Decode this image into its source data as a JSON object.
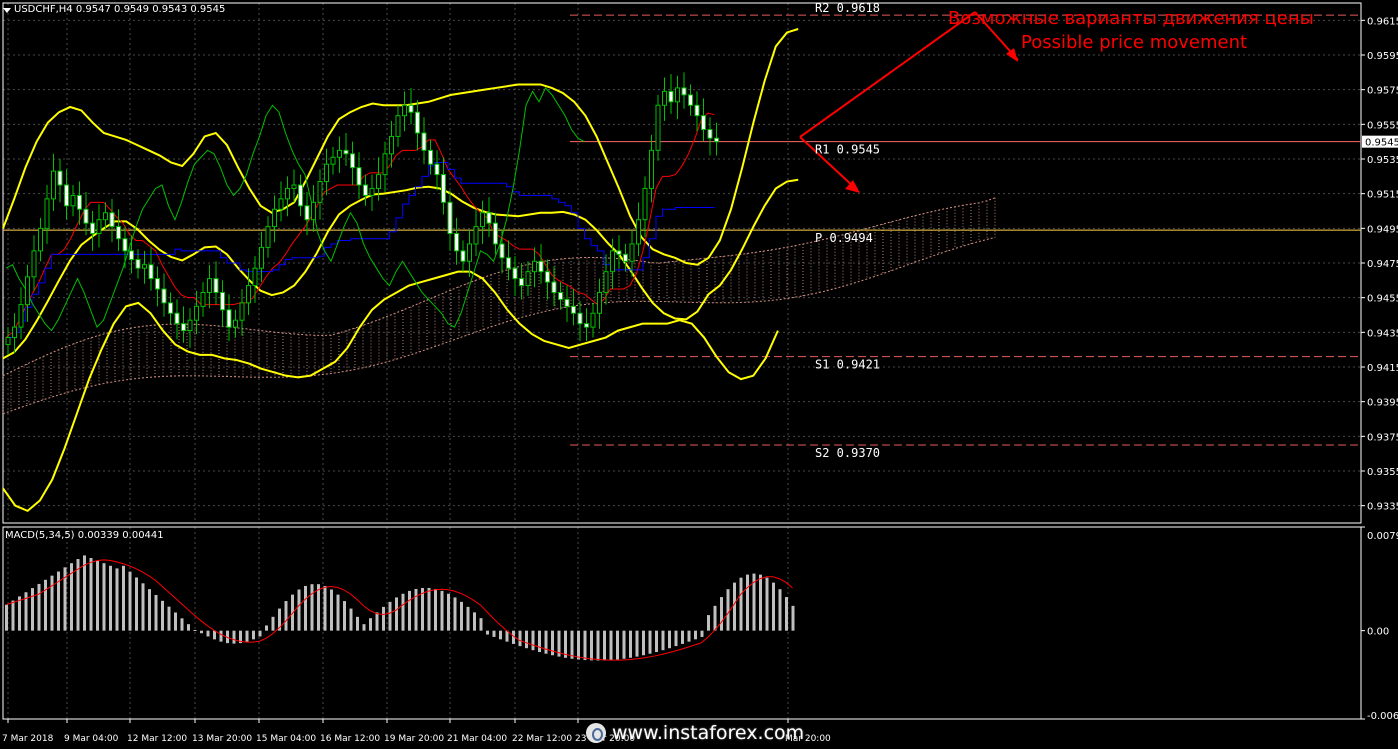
{
  "header": {
    "symbol_label": "USDCHF,H4  0.9547 0.9549 0.9543 0.9545"
  },
  "macd": {
    "label": "MACD(5,34,5) 0.00339 0.00441"
  },
  "annotations": {
    "note_ru": "Возможные варианты движения цены",
    "note_en": "Possible price movement"
  },
  "levels": [
    {
      "name": "R2",
      "label": "R2 0.9618",
      "value": 0.9618,
      "color": "#e85a5a"
    },
    {
      "name": "R1",
      "label": "R1 0.9545",
      "value": 0.9545,
      "color": "#ff6a6a"
    },
    {
      "name": "P",
      "label": "P 0.9494",
      "value": 0.9494,
      "color": "#ffd24d"
    },
    {
      "name": "S1",
      "label": "S1 0.9421",
      "value": 0.9421,
      "color": "#e85a5a"
    },
    {
      "name": "S2",
      "label": "S2 0.9370",
      "value": 0.937,
      "color": "#e85a5a"
    }
  ],
  "current_price": "0.9545",
  "watermark": "www.instaforex.com",
  "colors": {
    "background": "#000000",
    "bollinger": "#ffff00",
    "signal_line": "#ff0000",
    "kijun": "#0000ff",
    "chikou": "#00c000",
    "histogram": "#c0c0c0",
    "annotation": "#ff0000"
  },
  "chart_data": {
    "type": "candlestick",
    "symbol": "USDCHF",
    "timeframe": "H4",
    "ylim": [
      0.9325,
      0.9625
    ],
    "y_ticks": [
      "0.9615",
      "0.9595",
      "0.9575",
      "0.9555",
      "0.9535",
      "0.9515",
      "0.9495",
      "0.9475",
      "0.9455",
      "0.9435",
      "0.9415",
      "0.9395",
      "0.9375",
      "0.9355",
      "0.9335"
    ],
    "x_ticks": [
      "7 Mar 2018",
      "9 Mar 04:00",
      "12 Mar 12:00",
      "13 Mar 20:00",
      "15 Mar 04:00",
      "16 Mar 12:00",
      "19 Mar 20:00",
      "21 Mar 04:00",
      "22 Mar 12:00",
      "23 Mar 20:00",
      "Mar 20:00"
    ],
    "close": [
      0.9432,
      0.9438,
      0.9451,
      0.9467,
      0.9482,
      0.9495,
      0.9512,
      0.9528,
      0.952,
      0.9508,
      0.9514,
      0.9506,
      0.9498,
      0.9492,
      0.95,
      0.9504,
      0.9496,
      0.9489,
      0.9482,
      0.9477,
      0.9472,
      0.9474,
      0.9466,
      0.946,
      0.9452,
      0.9446,
      0.944,
      0.9436,
      0.9442,
      0.945,
      0.9458,
      0.9466,
      0.9458,
      0.9448,
      0.9438,
      0.9442,
      0.9452,
      0.9462,
      0.9472,
      0.9484,
      0.9496,
      0.9506,
      0.9512,
      0.9518,
      0.952,
      0.9508,
      0.95,
      0.951,
      0.9522,
      0.9532,
      0.9536,
      0.954,
      0.9538,
      0.953,
      0.952,
      0.9514,
      0.9518,
      0.9526,
      0.9538,
      0.9548,
      0.956,
      0.9566,
      0.9562,
      0.955,
      0.954,
      0.9532,
      0.9526,
      0.951,
      0.9492,
      0.9482,
      0.9476,
      0.9486,
      0.9496,
      0.9504,
      0.9498,
      0.9486,
      0.9478,
      0.9472,
      0.9466,
      0.9462,
      0.947,
      0.9476,
      0.947,
      0.9464,
      0.9458,
      0.9454,
      0.945,
      0.9446,
      0.944,
      0.9438,
      0.9446,
      0.9458,
      0.947,
      0.9482,
      0.948,
      0.9476,
      0.9486,
      0.95,
      0.9518,
      0.954,
      0.9566,
      0.9574,
      0.9568,
      0.9576,
      0.9572,
      0.9566,
      0.956,
      0.9552,
      0.9547,
      0.9545
    ],
    "bollinger_upper": [
      0.9495,
      0.9512,
      0.953,
      0.9545,
      0.9556,
      0.9562,
      0.9565,
      0.9563,
      0.9556,
      0.955,
      0.9548,
      0.9546,
      0.9543,
      0.954,
      0.9537,
      0.9533,
      0.9531,
      0.9538,
      0.9548,
      0.955,
      0.9543,
      0.953,
      0.9518,
      0.9508,
      0.9504,
      0.9506,
      0.951,
      0.9522,
      0.9535,
      0.9548,
      0.9558,
      0.9562,
      0.9565,
      0.9567,
      0.9566,
      0.9566,
      0.9566,
      0.9567,
      0.9568,
      0.957,
      0.9572,
      0.9573,
      0.9574,
      0.9575,
      0.9576,
      0.9577,
      0.9578,
      0.9578,
      0.9578,
      0.9576,
      0.9573,
      0.9568,
      0.956,
      0.9548,
      0.9533,
      0.9518,
      0.9502,
      0.949,
      0.9483,
      0.948,
      0.9478,
      0.9475,
      0.9474,
      0.9478,
      0.9488,
      0.9506,
      0.953,
      0.9556,
      0.958,
      0.96,
      0.9608,
      0.961
    ],
    "bollinger_lower": [
      0.9345,
      0.9335,
      0.9332,
      0.9338,
      0.935,
      0.9368,
      0.9388,
      0.9408,
      0.9425,
      0.944,
      0.945,
      0.9452,
      0.9446,
      0.9436,
      0.9428,
      0.9424,
      0.9422,
      0.9422,
      0.942,
      0.9419,
      0.9417,
      0.9414,
      0.9412,
      0.941,
      0.9409,
      0.941,
      0.9414,
      0.9418,
      0.9426,
      0.9438,
      0.9448,
      0.9454,
      0.9458,
      0.9462,
      0.9464,
      0.9466,
      0.9468,
      0.947,
      0.947,
      0.9466,
      0.9458,
      0.9448,
      0.944,
      0.9434,
      0.943,
      0.9428,
      0.9426,
      0.9428,
      0.943,
      0.9432,
      0.9436,
      0.9438,
      0.944,
      0.944,
      0.944,
      0.9442,
      0.944,
      0.9432,
      0.9421,
      0.9412,
      0.9408,
      0.941,
      0.942,
      0.9436
    ]
  }
}
